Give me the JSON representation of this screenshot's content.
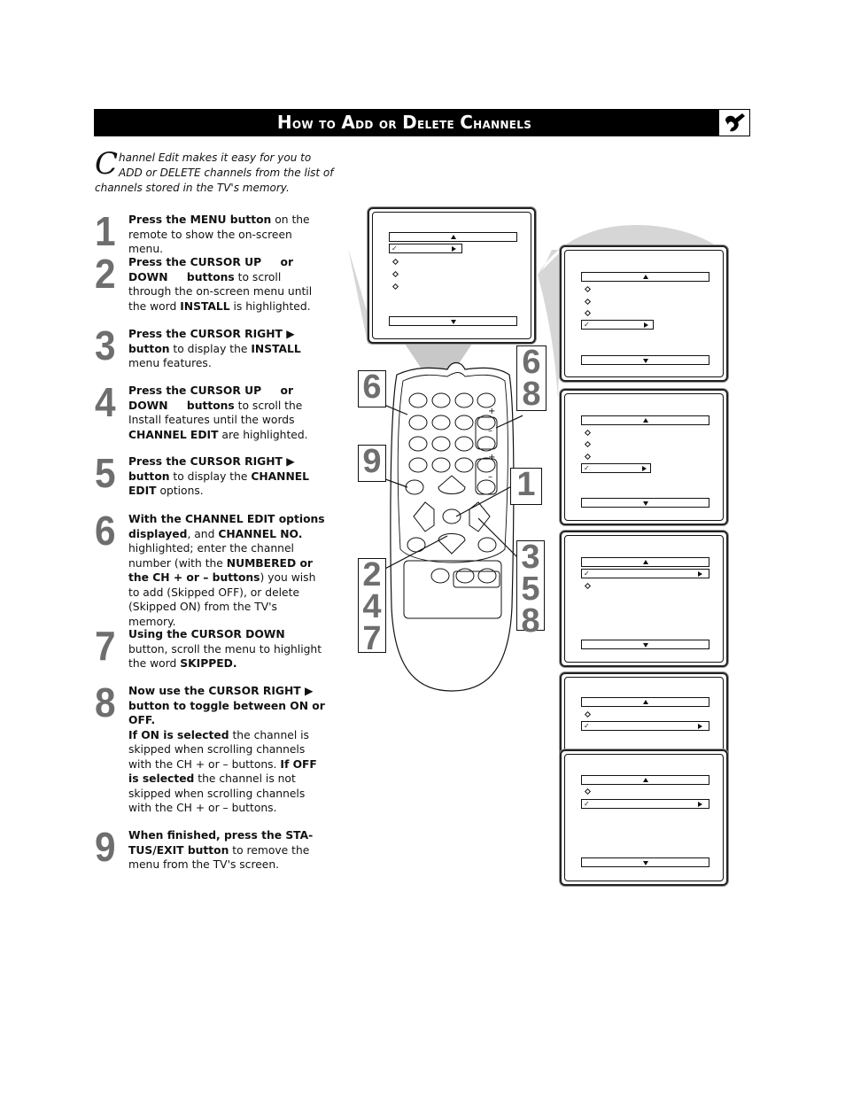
{
  "header": {
    "title_parts": [
      {
        "cap": "H",
        "rest": "ow to "
      },
      {
        "cap": "A",
        "rest": "dd or "
      },
      {
        "cap": "D",
        "rest": "elete "
      },
      {
        "cap": "C",
        "rest": "hannels"
      }
    ],
    "icon": "wrench-icon"
  },
  "intro": {
    "dropcap": "C",
    "text": "hannel Edit makes it easy for you to ADD or DELETE channels from the list of channels stored in the TV's memory."
  },
  "steps": [
    {
      "num": "1",
      "html": "<b>Press the MENU button</b> on the remote to show the on-screen menu."
    },
    {
      "num": "2",
      "html": "<b>Press the CURSOR UP &nbsp;&nbsp;&nbsp; or DOWN &nbsp;&nbsp;&nbsp; buttons</b> to scroll through the on-screen menu until the word <b>INSTALL</b> is highlighted."
    },
    {
      "num": "3",
      "html": "<b>Press the CURSOR RIGHT &#9654; button</b> to display the <b>INSTALL</b> menu features."
    },
    {
      "num": "4",
      "html": "<b>Press the CURSOR UP &nbsp;&nbsp;&nbsp; or DOWN &nbsp;&nbsp;&nbsp; buttons</b> to scroll the Install features until the words <b>CHANNEL EDIT</b> are highlighted."
    },
    {
      "num": "5",
      "html": "<b>Press the CURSOR RIGHT &#9654; button</b> to display the <b>CHANNEL EDIT</b> options."
    },
    {
      "num": "6",
      "html": "<b>With the CHANNEL EDIT options displayed</b>, and <b>CHANNEL NO.</b> highlighted; enter the channel number (with the <b>NUMBERED or the CH + or – buttons</b>) you wish to add (Skipped OFF), or delete (Skipped ON) from the TV's memory."
    },
    {
      "num": "7",
      "html": "<b>Using the CURSOR DOWN</b> button, scroll the menu to highlight the word <b>SKIPPED.</b>"
    },
    {
      "num": "8",
      "html": "<b>Now use the CURSOR RIGHT &#9654; button to toggle between ON or OFF.</b><br><b>If ON is selected</b> the channel is skipped when scrolling channels with the CH + or – buttons. <b>If OFF is selected</b> the channel is not skipped when scrolling channels with the CH + or – buttons."
    },
    {
      "num": "9",
      "html": "<b>When finished, press the STA-TUS/EXIT button</b> to remove the menu from the TV's screen."
    }
  ],
  "callouts": {
    "left_top": [
      "6"
    ],
    "right_top": [
      "6",
      "8"
    ],
    "left_mid": [
      "9"
    ],
    "right_mid": [
      "1"
    ],
    "left_bottom": [
      "2",
      "4",
      "7"
    ],
    "right_bottom": [
      "3",
      "5",
      "8"
    ]
  },
  "remote": {
    "plus_label": "+",
    "minus_label": "–"
  }
}
